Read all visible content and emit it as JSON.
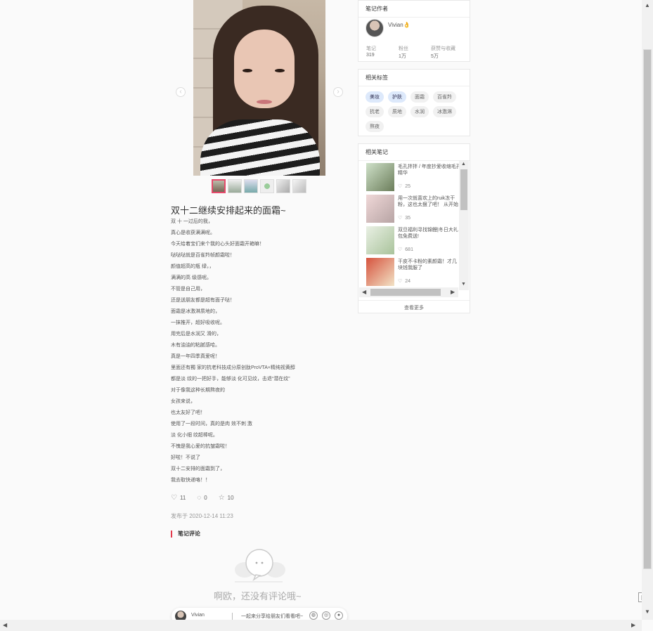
{
  "note": {
    "title": "双十二继续安排起来的面霜~",
    "body": [
      "双 十 一过后的我，",
      "真心是收获满满呢。",
      "今天给着宝们来个我的心头好面霜开箱嘛！",
      "哒哒哒就是百雀羚帧颜霜啦！",
      "颜值超高的瓶 绿，，",
      "满满的高 级感呢。",
      "不管是自己用，",
      "还是送朋友都是超有面子哒！",
      "面霜是冰激淋质地的，",
      "一抹推开，超好吸收呢。",
      "用完后是水润又 滑的，",
      "木有油油的粘腻感哈。",
      "真是一年四季真爱呢！",
      "里面还有獨 家的抗老科技成分原创肽ProVTA+精纯视黄醇",
      "都是淡 纹的一把好手，能够淡 化可见纹，击退“潜在纹”",
      "对于像我这种长期熬夜的",
      "女孩来说，",
      "也太友好了吧！",
      "使用了一段时间，真的是肉 效不刺 激",
      "淡 化小细 纹超棒呢。",
      "不愧是我心爱的抗皱霜啦！",
      "好啦！不说了",
      "双十二安排的面霜到了，",
      "我去取快递咯！！"
    ],
    "likes": "11",
    "comments": "0",
    "collects": "10",
    "published": "发布于 2020-12-14 11:23",
    "comments_title": "笔记评论",
    "empty_comments": "啊欧，还没有评论哦~",
    "nav_prev": "‹",
    "nav_next": "›"
  },
  "author_card": {
    "heading": "笔记作者",
    "name": "Vivian👌",
    "stats": [
      {
        "label": "笔记",
        "value": "319"
      },
      {
        "label": "粉丝",
        "value": "1万"
      },
      {
        "label": "获赞与收藏",
        "value": "5万"
      }
    ]
  },
  "tags_card": {
    "heading": "相关标签",
    "tags": [
      "美妆",
      "护肤",
      "面霜",
      "百雀羚",
      "抗老",
      "质地",
      "水润",
      "冰激淋",
      "熬夜"
    ]
  },
  "related_card": {
    "heading": "相关笔记",
    "items": [
      {
        "title": "毛孔拌拌 / 年度抄爱收缩毛孔精华",
        "likes": "25"
      },
      {
        "title": "用一次就喜欢上的ruik冻干粉，这也太狠了吧！ 从开始",
        "likes": "35"
      },
      {
        "title": "双旦福利寻找锦鲤|冬日大礼包免费送!",
        "likes": "681"
      },
      {
        "title": "干皮不卡粉的素颜霜！才几块钱我服了",
        "likes": "24"
      }
    ],
    "more": "查看更多"
  },
  "share_bar": {
    "name": "Vivian",
    "text": "一起来分享给朋友们看看吧~",
    "icons": [
      "wechat-icon",
      "moments-icon",
      "weibo-icon"
    ]
  },
  "icons": {
    "like": "♡",
    "comment": "◌",
    "collect": "☆",
    "heart_small": "♡",
    "up": "▲",
    "down": "▼",
    "left": "◀",
    "right": "▶",
    "qr": "▦"
  }
}
